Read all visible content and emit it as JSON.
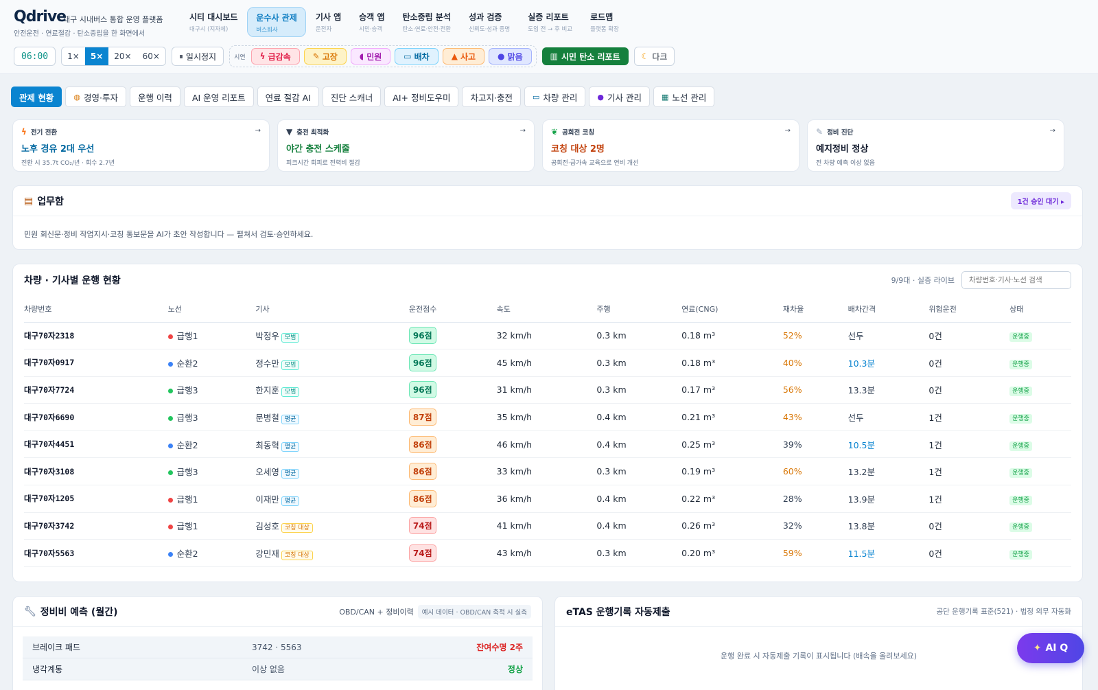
{
  "brand": {
    "name": "Qdrive",
    "sub": "대구 시내버스 통합 운영 플랫폼",
    "tagline": "안전운전 · 연료절감 · 탄소중립을 한 화면에서"
  },
  "nav": [
    {
      "t": "시티 대시보드",
      "s": "대구시 (지자체)"
    },
    {
      "t": "운수사 관제",
      "s": "버스회사"
    },
    {
      "t": "기사 앱",
      "s": "운전자"
    },
    {
      "t": "승객 앱",
      "s": "시민·승객"
    },
    {
      "t": "탄소중립 분석",
      "s": "탄소·연료·안전·전환"
    },
    {
      "t": "성과 검증",
      "s": "신뢰도·성과 증명"
    },
    {
      "t": "실증 리포트",
      "s": "도입 전 → 후 비교"
    },
    {
      "t": "로드맵",
      "s": "플랫폼 확장"
    }
  ],
  "controls": {
    "time": "06:00",
    "speeds": [
      "1×",
      "5×",
      "20×",
      "60×"
    ],
    "active_speed": "5×",
    "pause": "일시정지",
    "scenario_label": "시연",
    "scenarios": [
      {
        "label": "급감속",
        "icon": "lightning-icon",
        "color": "#e11d48",
        "bg": "#ffe4e6",
        "border": "#fda4af"
      },
      {
        "label": "고장",
        "icon": "wrench-icon",
        "color": "#d97706",
        "bg": "#fef3c7",
        "border": "#fcd34d"
      },
      {
        "label": "민원",
        "icon": "megaphone-icon",
        "color": "#a21caf",
        "bg": "#fae8ff",
        "border": "#f0abfc"
      },
      {
        "label": "배차",
        "icon": "bus-icon",
        "color": "#0369a1",
        "bg": "#e0f2fe",
        "border": "#7dd3fc"
      },
      {
        "label": "사고",
        "icon": "cone-icon",
        "color": "#ea580c",
        "bg": "#ffedd5",
        "border": "#fdba74"
      },
      {
        "label": "맑음",
        "icon": "sun-icon",
        "color": "#4f46e5",
        "bg": "#e0e7ff",
        "border": "#a5b4fc"
      }
    ],
    "report_btn": "시민 탄소 리포트",
    "dark_btn": "다크"
  },
  "tabs": [
    "관제 현황",
    "경영·투자",
    "운행 이력",
    "AI 운영 리포트",
    "연료 절감 AI",
    "진단 스캐너",
    "AI+ 정비도우미",
    "차고지·충전",
    "차량 관리",
    "기사 관리",
    "노선 관리"
  ],
  "cards": [
    {
      "label": "전기 전환",
      "title": "노후 경유 2대 우선",
      "sub": "전환 시 35.7t CO₂/년 · 회수 2.7년",
      "color": "#0369a1"
    },
    {
      "label": "충전 최적화",
      "title": "야간 충전 스케줄",
      "sub": "피크시간 회피로 전력비 절감",
      "color": "#15803d"
    },
    {
      "label": "공회전 코칭",
      "title": "코칭 대상 2명",
      "sub": "공회전·급가속 교육으로 연비 개선",
      "color": "#c2410c"
    },
    {
      "label": "정비 진단",
      "title": "예지정비 정상",
      "sub": "전 차량 예측 이상 없음",
      "color": "#0f172a"
    }
  ],
  "workbox": {
    "title": "업무함",
    "pending": "1건 승인 대기 ▸",
    "desc": "민원 회신문·정비 작업지시·코칭 통보문을 AI가 초안 작성합니다 — 펼쳐서 검토·승인하세요."
  },
  "fleet": {
    "title": "차량 · 기사별 운행 현황",
    "count": "9/9대 · 실증 라이브",
    "search_placeholder": "차량번호·기사·노선 검색",
    "headers": [
      "차량번호",
      "노선",
      "기사",
      "운전점수",
      "속도",
      "주행",
      "연료(CNG)",
      "재차율",
      "배차간격",
      "위험운전",
      "상태"
    ],
    "rows": [
      {
        "plate": "대구70자2318",
        "route": "급행1",
        "rc": "#ef4444",
        "driver": "박정우",
        "grade": "모범",
        "score": "96점",
        "speed": "32 km/h",
        "dist": "0.3 km",
        "fuel": "0.18 m³",
        "load": "52%",
        "loadc": "#d97706",
        "gap": "선두",
        "gapc": "#334155",
        "risk": "0건",
        "status": "운행중"
      },
      {
        "plate": "대구70자0917",
        "route": "순환2",
        "rc": "#3b82f6",
        "driver": "정수만",
        "grade": "모범",
        "score": "96점",
        "speed": "45 km/h",
        "dist": "0.3 km",
        "fuel": "0.18 m³",
        "load": "40%",
        "loadc": "#d97706",
        "gap": "10.3분",
        "gapc": "#0a84d0",
        "risk": "0건",
        "status": "운행중"
      },
      {
        "plate": "대구70자7724",
        "route": "급행3",
        "rc": "#22c55e",
        "driver": "한지훈",
        "grade": "모범",
        "score": "96점",
        "speed": "31 km/h",
        "dist": "0.3 km",
        "fuel": "0.17 m³",
        "load": "56%",
        "loadc": "#d97706",
        "gap": "13.3분",
        "gapc": "#334155",
        "risk": "0건",
        "status": "운행중"
      },
      {
        "plate": "대구70자6690",
        "route": "급행3",
        "rc": "#22c55e",
        "driver": "문병철",
        "grade": "평균",
        "score": "87점",
        "speed": "35 km/h",
        "dist": "0.4 km",
        "fuel": "0.21 m³",
        "load": "43%",
        "loadc": "#d97706",
        "gap": "선두",
        "gapc": "#334155",
        "risk": "1건",
        "status": "운행중"
      },
      {
        "plate": "대구70자4451",
        "route": "순환2",
        "rc": "#3b82f6",
        "driver": "최동혁",
        "grade": "평균",
        "score": "86점",
        "speed": "46 km/h",
        "dist": "0.4 km",
        "fuel": "0.25 m³",
        "load": "39%",
        "loadc": "#334155",
        "gap": "10.5분",
        "gapc": "#0a84d0",
        "risk": "1건",
        "status": "운행중"
      },
      {
        "plate": "대구70자3108",
        "route": "급행3",
        "rc": "#22c55e",
        "driver": "오세영",
        "grade": "평균",
        "score": "86점",
        "speed": "33 km/h",
        "dist": "0.3 km",
        "fuel": "0.19 m³",
        "load": "60%",
        "loadc": "#d97706",
        "gap": "13.2분",
        "gapc": "#334155",
        "risk": "1건",
        "status": "운행중"
      },
      {
        "plate": "대구70자1205",
        "route": "급행1",
        "rc": "#ef4444",
        "driver": "이재만",
        "grade": "평균",
        "score": "86점",
        "speed": "36 km/h",
        "dist": "0.4 km",
        "fuel": "0.22 m³",
        "load": "28%",
        "loadc": "#334155",
        "gap": "13.9분",
        "gapc": "#334155",
        "risk": "1건",
        "status": "운행중"
      },
      {
        "plate": "대구70자3742",
        "route": "급행1",
        "rc": "#ef4444",
        "driver": "김성호",
        "grade": "코칭 대상",
        "score": "74점",
        "speed": "41 km/h",
        "dist": "0.4 km",
        "fuel": "0.26 m³",
        "load": "32%",
        "loadc": "#334155",
        "gap": "13.8분",
        "gapc": "#334155",
        "risk": "0건",
        "status": "운행중"
      },
      {
        "plate": "대구70자5563",
        "route": "순환2",
        "rc": "#3b82f6",
        "driver": "강민재",
        "grade": "코칭 대상",
        "score": "74점",
        "speed": "43 km/h",
        "dist": "0.3 km",
        "fuel": "0.20 m³",
        "load": "59%",
        "loadc": "#d97706",
        "gap": "11.5분",
        "gapc": "#0a84d0",
        "risk": "0건",
        "status": "운행중"
      }
    ]
  },
  "maintenance": {
    "title": "정비비 예측 (월간)",
    "source": "OBD/CAN + 정비이력",
    "note": "예시 데이터 · OBD/CAN 축적 시 실측",
    "rows": [
      {
        "part": "브레이크 패드",
        "buses": "3742 · 5563",
        "status": "잔여수명 2주",
        "sc": "#dc2626"
      },
      {
        "part": "냉각계통",
        "buses": "이상 없음",
        "status": "정상",
        "sc": "#16a34a"
      }
    ]
  },
  "etas": {
    "title": "eTAS 운행기록 자동제출",
    "meta": "공단 운행기록 표준(521) · 법정 의무 자동화",
    "empty": "운행 완료 시 자동제출 기록이 표시됩니다 (배속을 올려보세요)"
  },
  "aiq": "AI Q"
}
